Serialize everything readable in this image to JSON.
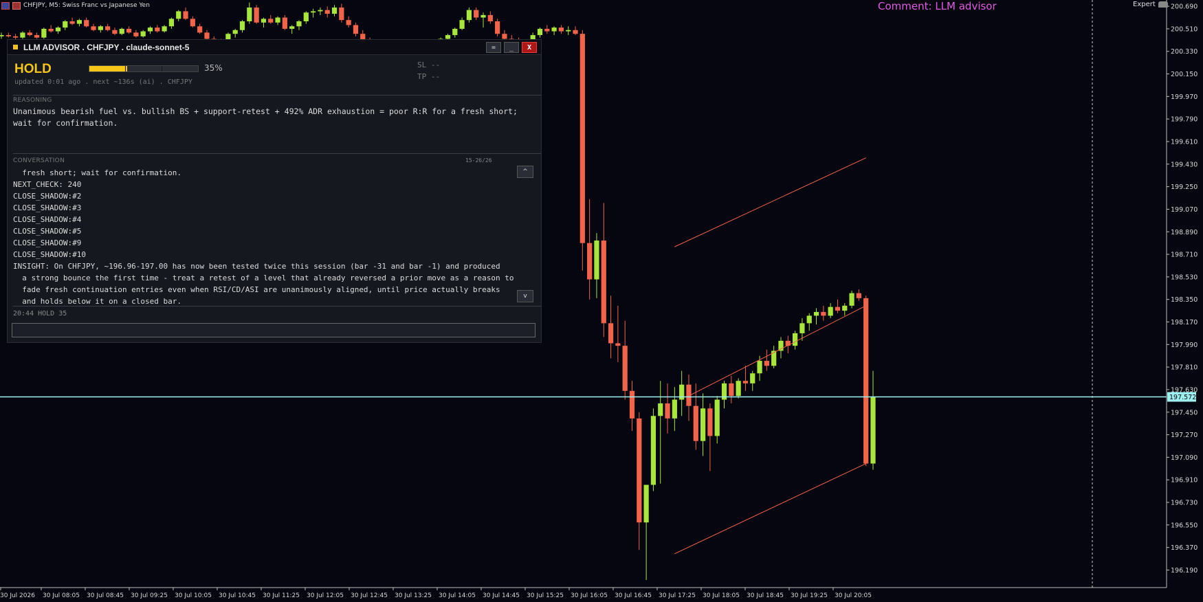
{
  "window": {
    "symbol_title": "CHFJPY, M5:  Swiss Franc vs Japanese Yen",
    "comment": "Comment: LLM advisor",
    "expert_label": "Expert"
  },
  "colors": {
    "background": "#05060f",
    "bull": "#a8e63c",
    "bear": "#f2644a",
    "channel": "#f2644a",
    "price_line": "#9ef0f0",
    "accent": "#f5c518",
    "comment": "#e05ce0"
  },
  "panel": {
    "title": "LLM ADVISOR . CHFJPY . claude-sonnet-5",
    "buttons": {
      "menu": "=",
      "minimize": "_",
      "close": "X"
    },
    "signal": "HOLD",
    "confidence": 35,
    "confidence_label": "35%",
    "updated": "updated 0:01 ago . next ~136s (ai) . CHFJPY",
    "sl": "SL --",
    "tp": "TP --",
    "reasoning_label": "REASONING",
    "reasoning": "Unanimous bearish fuel vs. bullish BS + support-retest + 492% ADR exhaustion = poor R:R for a fresh short; wait for confirmation.",
    "conversation_label": "CONVERSATION",
    "conversation_count": "15-26/26",
    "conversation": [
      "  fresh short; wait for confirmation.",
      "NEXT_CHECK: 240",
      "CLOSE_SHADOW:#2",
      "CLOSE_SHADOW:#3",
      "CLOSE_SHADOW:#4",
      "CLOSE_SHADOW:#5",
      "CLOSE_SHADOW:#9",
      "CLOSE_SHADOW:#10",
      "INSIGHT: On CHFJPY, ~196.96-197.00 has now been tested twice this session (bar -31 and bar -1) and produced",
      "  a strong bounce the first time - treat a retest of a level that already reversed a prior move as a reason to",
      "  fade fresh continuation entries even when RSI/CD/ASI are unanimously aligned, until price actually breaks",
      "  and holds below it on a closed bar."
    ],
    "scroll_up": "^",
    "scroll_down": "v",
    "status_line": "20:44 HOLD 35",
    "input_value": ""
  },
  "chart_data": {
    "type": "candlestick",
    "symbol": "CHFJPY",
    "timeframe": "M5",
    "y_ticks": [
      200.69,
      200.51,
      200.33,
      200.15,
      199.97,
      199.79,
      199.61,
      199.43,
      199.25,
      199.07,
      198.89,
      198.71,
      198.53,
      198.35,
      198.17,
      197.99,
      197.81,
      197.63,
      197.45,
      197.27,
      197.09,
      196.91,
      196.73,
      196.55,
      196.37,
      196.19
    ],
    "y_tick_labels": [
      "200.690",
      "200.510",
      "200.330",
      "200.150",
      "199.970",
      "199.790",
      "199.610",
      "199.430",
      "199.250",
      "199.070",
      "198.890",
      "198.710",
      "198.530",
      "198.350",
      "198.170",
      "197.990",
      "197.810",
      "197.630",
      "197.450",
      "197.270",
      "197.090",
      "196.910",
      "196.730",
      "196.550",
      "196.370",
      "196.190"
    ],
    "ylim": [
      196.05,
      200.74
    ],
    "x_tick_labels": [
      "30 Jul 2026",
      "30 Jul 08:05",
      "30 Jul 08:45",
      "30 Jul 09:25",
      "30 Jul 10:05",
      "30 Jul 10:45",
      "30 Jul 11:25",
      "30 Jul 12:05",
      "30 Jul 12:45",
      "30 Jul 13:25",
      "30 Jul 14:05",
      "30 Jul 14:45",
      "30 Jul 15:25",
      "30 Jul 16:05",
      "30 Jul 16:45",
      "30 Jul 17:25",
      "30 Jul 18:05",
      "30 Jul 18:45",
      "30 Jul 19:25",
      "30 Jul 20:05"
    ],
    "current_price": 197.572,
    "current_price_label": "197.572",
    "channel": {
      "upper": [
        [
          95,
          198.77
        ],
        [
          122,
          199.48
        ]
      ],
      "lower": [
        [
          95,
          196.32
        ],
        [
          122,
          197.04
        ]
      ],
      "mid": [
        [
          97,
          197.58
        ],
        [
          122,
          198.3
        ]
      ]
    },
    "candles": [
      [
        200.45,
        200.48,
        200.43,
        200.46
      ],
      [
        200.46,
        200.48,
        200.44,
        200.45
      ],
      [
        200.45,
        200.47,
        200.42,
        200.44
      ],
      [
        200.44,
        200.49,
        200.43,
        200.48
      ],
      [
        200.48,
        200.5,
        200.45,
        200.46
      ],
      [
        200.46,
        200.48,
        200.43,
        200.44
      ],
      [
        200.44,
        200.52,
        200.43,
        200.51
      ],
      [
        200.51,
        200.54,
        200.48,
        200.49
      ],
      [
        200.49,
        200.53,
        200.47,
        200.52
      ],
      [
        200.52,
        200.58,
        200.5,
        200.57
      ],
      [
        200.57,
        200.6,
        200.54,
        200.55
      ],
      [
        200.55,
        200.59,
        200.53,
        200.58
      ],
      [
        200.58,
        200.6,
        200.52,
        200.53
      ],
      [
        200.53,
        200.55,
        200.49,
        200.5
      ],
      [
        200.5,
        200.54,
        200.48,
        200.53
      ],
      [
        200.53,
        200.55,
        200.49,
        200.5
      ],
      [
        200.5,
        200.52,
        200.46,
        200.47
      ],
      [
        200.47,
        200.52,
        200.46,
        200.51
      ],
      [
        200.51,
        200.53,
        200.47,
        200.48
      ],
      [
        200.48,
        200.5,
        200.44,
        200.45
      ],
      [
        200.45,
        200.5,
        200.44,
        200.49
      ],
      [
        200.49,
        200.53,
        200.47,
        200.52
      ],
      [
        200.52,
        200.54,
        200.48,
        200.49
      ],
      [
        200.49,
        200.54,
        200.48,
        200.53
      ],
      [
        200.53,
        200.6,
        200.51,
        200.59
      ],
      [
        200.59,
        200.66,
        200.57,
        200.65
      ],
      [
        200.65,
        200.68,
        200.58,
        200.59
      ],
      [
        200.59,
        200.61,
        200.52,
        200.53
      ],
      [
        200.53,
        200.55,
        200.47,
        200.48
      ],
      [
        200.48,
        200.5,
        200.42,
        200.43
      ],
      [
        200.43,
        200.45,
        200.38,
        200.41
      ],
      [
        200.41,
        200.43,
        200.37,
        200.4
      ],
      [
        200.4,
        200.48,
        200.38,
        200.47
      ],
      [
        200.47,
        200.51,
        200.44,
        200.5
      ],
      [
        200.5,
        200.58,
        200.48,
        200.57
      ],
      [
        200.57,
        200.72,
        200.55,
        200.68
      ],
      [
        200.68,
        200.7,
        200.55,
        200.56
      ],
      [
        200.56,
        200.6,
        200.52,
        200.59
      ],
      [
        200.59,
        200.62,
        200.55,
        200.56
      ],
      [
        200.56,
        200.61,
        200.54,
        200.6
      ],
      [
        200.6,
        200.62,
        200.5,
        200.51
      ],
      [
        200.51,
        200.54,
        200.47,
        200.53
      ],
      [
        200.53,
        200.58,
        200.5,
        200.57
      ],
      [
        200.57,
        200.65,
        200.55,
        200.64
      ],
      [
        200.64,
        200.67,
        200.6,
        200.65
      ],
      [
        200.65,
        200.68,
        200.62,
        200.66
      ],
      [
        200.66,
        200.69,
        200.6,
        200.63
      ],
      [
        200.63,
        200.7,
        200.61,
        200.68
      ],
      [
        200.68,
        200.71,
        200.56,
        200.58
      ],
      [
        200.58,
        200.61,
        200.52,
        200.54
      ],
      [
        200.54,
        200.56,
        200.45,
        200.47
      ],
      [
        200.47,
        200.5,
        200.4,
        200.42
      ],
      [
        200.42,
        200.44,
        200.35,
        200.38
      ],
      [
        200.38,
        200.41,
        200.33,
        200.36
      ],
      [
        200.36,
        200.38,
        200.3,
        200.32
      ],
      [
        200.32,
        200.35,
        200.28,
        200.31
      ],
      [
        200.31,
        200.33,
        200.26,
        200.28
      ],
      [
        200.28,
        200.32,
        200.25,
        200.3
      ],
      [
        200.3,
        200.34,
        200.27,
        200.33
      ],
      [
        200.33,
        200.36,
        200.3,
        200.34
      ],
      [
        200.34,
        200.37,
        200.31,
        200.35
      ],
      [
        200.35,
        200.4,
        200.33,
        200.39
      ],
      [
        200.39,
        200.44,
        200.37,
        200.43
      ],
      [
        200.43,
        200.47,
        200.4,
        200.46
      ],
      [
        200.46,
        200.52,
        200.44,
        200.51
      ],
      [
        200.51,
        200.6,
        200.5,
        200.58
      ],
      [
        200.58,
        200.68,
        200.56,
        200.66
      ],
      [
        200.66,
        200.68,
        200.58,
        200.6
      ],
      [
        200.6,
        200.64,
        200.52,
        200.62
      ],
      [
        200.62,
        200.65,
        200.55,
        200.57
      ],
      [
        200.57,
        200.59,
        200.45,
        200.47
      ],
      [
        200.47,
        200.5,
        200.41,
        200.43
      ],
      [
        200.43,
        200.46,
        200.36,
        200.4
      ],
      [
        200.4,
        200.44,
        200.35,
        200.38
      ],
      [
        200.38,
        200.41,
        200.33,
        200.4
      ],
      [
        200.4,
        200.48,
        200.38,
        200.46
      ],
      [
        200.46,
        200.52,
        200.44,
        200.51
      ],
      [
        200.51,
        200.54,
        200.47,
        200.49
      ],
      [
        200.49,
        200.53,
        200.46,
        200.52
      ],
      [
        200.52,
        200.54,
        200.47,
        200.49
      ],
      [
        200.49,
        200.53,
        200.46,
        200.5
      ],
      [
        200.5,
        200.53,
        200.46,
        200.47
      ],
      [
        200.47,
        200.5,
        198.58,
        198.8
      ],
      [
        198.8,
        199.15,
        198.35,
        198.51
      ],
      [
        198.51,
        198.88,
        198.36,
        198.82
      ],
      [
        198.82,
        199.12,
        198.05,
        198.16
      ],
      [
        198.16,
        198.38,
        197.88,
        198.0
      ],
      [
        198.0,
        198.3,
        197.85,
        197.98
      ],
      [
        197.98,
        198.18,
        197.55,
        197.62
      ],
      [
        197.62,
        197.7,
        197.3,
        197.4
      ],
      [
        197.4,
        197.45,
        196.35,
        196.57
      ],
      [
        196.57,
        196.72,
        196.11,
        196.87
      ],
      [
        196.87,
        197.48,
        196.82,
        197.42
      ],
      [
        197.42,
        197.7,
        196.88,
        197.52
      ],
      [
        197.52,
        197.68,
        197.28,
        197.4
      ],
      [
        197.4,
        197.65,
        197.3,
        197.55
      ],
      [
        197.55,
        197.78,
        197.42,
        197.67
      ],
      [
        197.67,
        197.75,
        197.38,
        197.5
      ],
      [
        197.5,
        197.68,
        197.15,
        197.22
      ],
      [
        197.22,
        197.6,
        197.1,
        197.48
      ],
      [
        197.48,
        197.52,
        196.98,
        197.26
      ],
      [
        197.26,
        197.58,
        197.2,
        197.55
      ],
      [
        197.55,
        197.7,
        197.48,
        197.68
      ],
      [
        197.68,
        197.74,
        197.52,
        197.58
      ],
      [
        197.58,
        197.72,
        197.56,
        197.7
      ],
      [
        197.7,
        197.82,
        197.62,
        197.68
      ],
      [
        197.68,
        197.78,
        197.62,
        197.76
      ],
      [
        197.76,
        197.9,
        197.7,
        197.86
      ],
      [
        197.86,
        197.95,
        197.78,
        197.82
      ],
      [
        197.82,
        197.98,
        197.8,
        197.94
      ],
      [
        197.94,
        198.05,
        197.88,
        198.02
      ],
      [
        198.02,
        198.06,
        197.92,
        197.98
      ],
      [
        197.98,
        198.1,
        197.95,
        198.08
      ],
      [
        198.08,
        198.2,
        198.02,
        198.16
      ],
      [
        198.16,
        198.24,
        198.1,
        198.22
      ],
      [
        198.22,
        198.28,
        198.15,
        198.25
      ],
      [
        198.25,
        198.3,
        198.18,
        198.22
      ],
      [
        198.22,
        198.32,
        198.2,
        198.29
      ],
      [
        198.29,
        198.35,
        198.24,
        198.26
      ],
      [
        198.26,
        198.32,
        198.22,
        198.3
      ],
      [
        198.3,
        198.42,
        198.28,
        198.4
      ],
      [
        198.4,
        198.43,
        198.34,
        198.36
      ],
      [
        198.36,
        198.38,
        197.02,
        197.04
      ],
      [
        197.04,
        197.78,
        196.99,
        197.57
      ]
    ]
  }
}
